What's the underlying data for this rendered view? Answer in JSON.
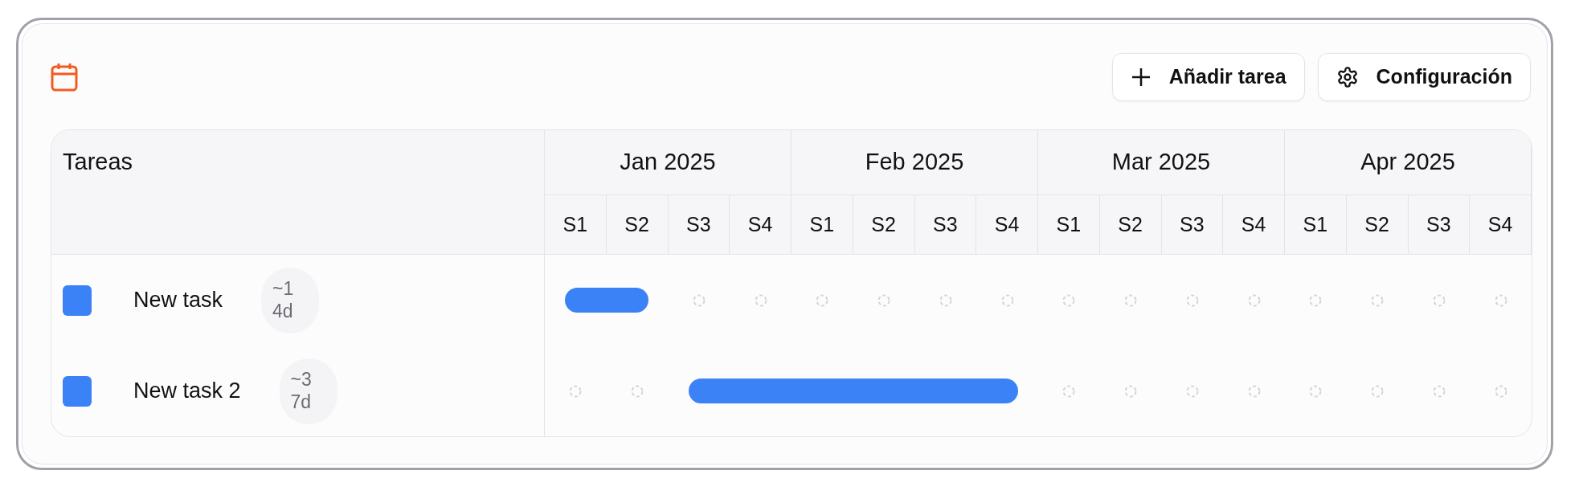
{
  "toolbar": {
    "buttons": [
      {
        "kind": "add",
        "label": "Añadir tarea"
      },
      {
        "kind": "settings",
        "label": "Configuración"
      }
    ]
  },
  "gantt": {
    "tasks_heading": "Tareas",
    "months": [
      {
        "label": "Jan 2025",
        "weeks": [
          "S1",
          "S2",
          "S3",
          "S4"
        ]
      },
      {
        "label": "Feb 2025",
        "weeks": [
          "S1",
          "S2",
          "S3",
          "S4"
        ]
      },
      {
        "label": "Mar 2025",
        "weeks": [
          "S1",
          "S2",
          "S3",
          "S4"
        ]
      },
      {
        "label": "Apr 2025",
        "weeks": [
          "S1",
          "S2",
          "S3",
          "S4"
        ]
      }
    ],
    "tasks": [
      {
        "name": "New task",
        "color": "#3b82f6",
        "estimate": "~1",
        "duration": "4d",
        "cells": [
          {
            "filled": true
          },
          {
            "filled": true
          },
          {
            "filled": false
          },
          {
            "filled": false
          },
          {
            "filled": false
          },
          {
            "filled": false
          },
          {
            "filled": false
          },
          {
            "filled": false
          },
          {
            "filled": false
          },
          {
            "filled": false
          },
          {
            "filled": false
          },
          {
            "filled": false
          },
          {
            "filled": false
          },
          {
            "filled": false
          },
          {
            "filled": false
          },
          {
            "filled": false
          }
        ]
      },
      {
        "name": "New task 2",
        "color": "#3b82f6",
        "estimate": "~3",
        "duration": "7d",
        "cells": [
          {
            "filled": false
          },
          {
            "filled": false
          },
          {
            "filled": true
          },
          {
            "filled": true
          },
          {
            "filled": true
          },
          {
            "filled": true
          },
          {
            "filled": true
          },
          {
            "filled": true
          },
          {
            "filled": false
          },
          {
            "filled": false
          },
          {
            "filled": false
          },
          {
            "filled": false
          },
          {
            "filled": false
          },
          {
            "filled": false
          },
          {
            "filled": false
          },
          {
            "filled": false
          }
        ]
      }
    ]
  }
}
